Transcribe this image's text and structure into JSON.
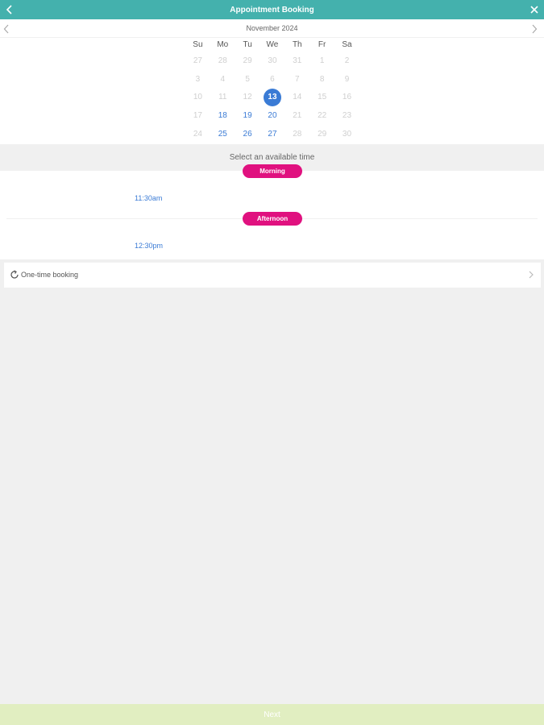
{
  "header": {
    "title": "Appointment Booking",
    "back_icon": "chevron-left-icon",
    "close_icon": "close-icon",
    "background": "#44b1ad"
  },
  "calendar": {
    "month_label": "November 2024",
    "weekdays": [
      "Su",
      "Mo",
      "Tu",
      "We",
      "Th",
      "Fr",
      "Sa"
    ],
    "weeks": [
      [
        {
          "d": "27",
          "s": "muted"
        },
        {
          "d": "28",
          "s": "muted"
        },
        {
          "d": "29",
          "s": "muted"
        },
        {
          "d": "30",
          "s": "muted"
        },
        {
          "d": "31",
          "s": "muted"
        },
        {
          "d": "1",
          "s": "muted"
        },
        {
          "d": "2",
          "s": "muted"
        }
      ],
      [
        {
          "d": "3",
          "s": "muted"
        },
        {
          "d": "4",
          "s": "muted"
        },
        {
          "d": "5",
          "s": "muted"
        },
        {
          "d": "6",
          "s": "muted"
        },
        {
          "d": "7",
          "s": "muted"
        },
        {
          "d": "8",
          "s": "muted"
        },
        {
          "d": "9",
          "s": "muted"
        }
      ],
      [
        {
          "d": "10",
          "s": "muted"
        },
        {
          "d": "11",
          "s": "muted"
        },
        {
          "d": "12",
          "s": "muted"
        },
        {
          "d": "13",
          "s": "selected"
        },
        {
          "d": "14",
          "s": "muted"
        },
        {
          "d": "15",
          "s": "muted"
        },
        {
          "d": "16",
          "s": "muted"
        }
      ],
      [
        {
          "d": "17",
          "s": "muted"
        },
        {
          "d": "18",
          "s": "available"
        },
        {
          "d": "19",
          "s": "available"
        },
        {
          "d": "20",
          "s": "available"
        },
        {
          "d": "21",
          "s": "muted"
        },
        {
          "d": "22",
          "s": "muted"
        },
        {
          "d": "23",
          "s": "muted"
        }
      ],
      [
        {
          "d": "24",
          "s": "muted"
        },
        {
          "d": "25",
          "s": "available"
        },
        {
          "d": "26",
          "s": "available"
        },
        {
          "d": "27",
          "s": "available"
        },
        {
          "d": "28",
          "s": "muted"
        },
        {
          "d": "29",
          "s": "muted"
        },
        {
          "d": "30",
          "s": "muted"
        }
      ]
    ],
    "accent": "#3a7bd5"
  },
  "time_select": {
    "prompt": "Select an available time",
    "morning_label": "Morning",
    "morning_slot": "11:30am",
    "afternoon_label": "Afternoon",
    "afternoon_slot": "12:30pm",
    "pill_color": "#e0117f"
  },
  "booking_type": {
    "label": "One-time booking",
    "icon": "refresh-icon"
  },
  "footer": {
    "next_label": "Next",
    "background": "#e1eec1"
  }
}
